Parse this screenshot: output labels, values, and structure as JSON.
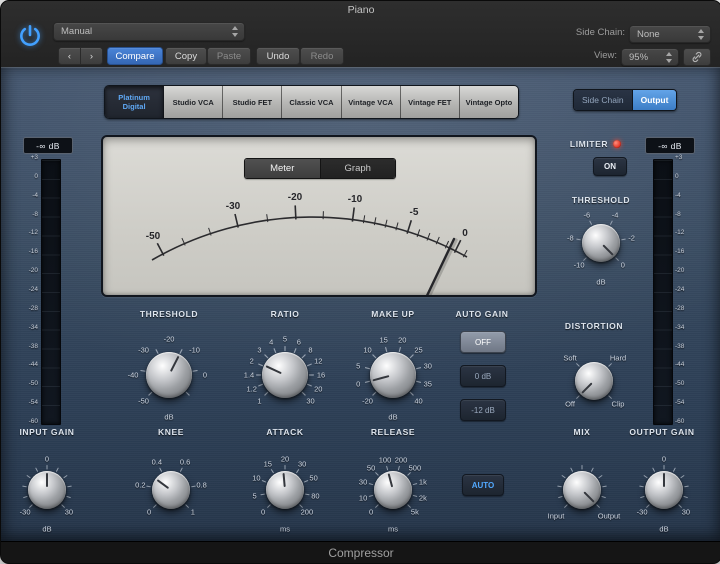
{
  "header": {
    "title": "Piano",
    "preset": "Manual",
    "side_chain_label": "Side Chain:",
    "side_chain_value": "None",
    "prev": "‹",
    "next": "›",
    "compare": "Compare",
    "copy": "Copy",
    "paste": "Paste",
    "undo": "Undo",
    "redo": "Redo",
    "view_label": "View:",
    "view_value": "95%"
  },
  "models": [
    "Platinum Digital",
    "Studio VCA",
    "Studio FET",
    "Classic VCA",
    "Vintage VCA",
    "Vintage FET",
    "Vintage Opto"
  ],
  "selected_model": "Platinum Digital",
  "routing": {
    "side_chain": "Side Chain",
    "output": "Output",
    "selected": "Output"
  },
  "display": {
    "meter_tab": "Meter",
    "graph_tab": "Graph",
    "scale": [
      "-50",
      "-30",
      "-20",
      "-10",
      "-5",
      "0"
    ]
  },
  "meters": {
    "input_readout": "-∞ dB",
    "output_readout": "-∞ dB",
    "scale": [
      "+3",
      "0",
      "-4",
      "-8",
      "-12",
      "-16",
      "-20",
      "-24",
      "-28",
      "-34",
      "-38",
      "-44",
      "-50",
      "-54",
      "-60"
    ]
  },
  "limiter": {
    "label": "LIMITER",
    "on": "ON"
  },
  "auto_gain": {
    "label": "AUTO GAIN",
    "options": [
      "OFF",
      "0 dB",
      "-12 dB"
    ],
    "selected": "OFF"
  },
  "auto_release": {
    "label": "AUTO"
  },
  "knobs": {
    "input_gain": {
      "label": "INPUT GAIN",
      "ticks": [
        "0",
        "-30",
        "30",
        "dB"
      ]
    },
    "threshold": {
      "label": "THRESHOLD",
      "ticks": [
        "-50",
        "-40",
        "-30",
        "-20",
        "-10",
        "0",
        "dB"
      ]
    },
    "ratio": {
      "label": "RATIO",
      "ticks": [
        "1",
        "1.2",
        "1.4",
        "2",
        "3",
        "4",
        "5",
        "6",
        "8",
        "12",
        "16",
        "20",
        "30"
      ]
    },
    "make_up": {
      "label": "MAKE UP",
      "ticks": [
        "-20",
        "0",
        "5",
        "10",
        "15",
        "20",
        "25",
        "30",
        "35",
        "40",
        "dB"
      ]
    },
    "knee": {
      "label": "KNEE",
      "ticks": [
        "0",
        "0.2",
        "0.4",
        "0.6",
        "0.8",
        "1"
      ]
    },
    "attack": {
      "label": "ATTACK",
      "ticks": [
        "0",
        "5",
        "10",
        "15",
        "20",
        "30",
        "50",
        "80",
        "200",
        "ms"
      ]
    },
    "release": {
      "label": "RELEASE",
      "ticks": [
        "0",
        "10",
        "30",
        "50",
        "100",
        "200",
        "500",
        "1k",
        "2k",
        "5k",
        "ms"
      ]
    },
    "limiter_threshold": {
      "label": "THRESHOLD",
      "ticks": [
        "-10",
        "-8",
        "-6",
        "-4",
        "-2",
        "0",
        "dB"
      ]
    },
    "distortion": {
      "label": "DISTORTION",
      "ticks": [
        "Off",
        "Soft",
        "Hard",
        "Clip"
      ]
    },
    "mix": {
      "label": "MIX",
      "ticks": [
        "Input",
        "Output"
      ]
    },
    "output_gain": {
      "label": "OUTPUT GAIN",
      "ticks": [
        "0",
        "-30",
        "30",
        "dB"
      ]
    }
  },
  "footer": {
    "title": "Compressor"
  },
  "colors": {
    "accent_blue": "#4a84d8",
    "selected_text_blue": "#5fa8f5",
    "led_red": "#e63b2c",
    "body_blue": "#36495f"
  }
}
